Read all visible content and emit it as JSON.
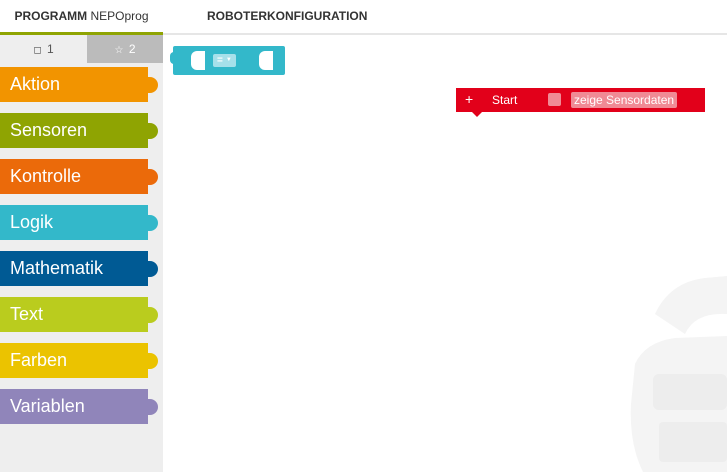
{
  "tabs": {
    "program_strong": "PROGRAMM",
    "program_name": "NEPOprog",
    "robot_config": "ROBOTERKONFIGURATION"
  },
  "toolbox": {
    "levels": [
      {
        "icon": "square-icon",
        "label": "1"
      },
      {
        "icon": "star-icon",
        "label": "2"
      }
    ],
    "categories": [
      {
        "label": "Aktion",
        "color": "#f29400"
      },
      {
        "label": "Sensoren",
        "color": "#8fa402"
      },
      {
        "label": "Kontrolle",
        "color": "#eb6a0a"
      },
      {
        "label": "Logik",
        "color": "#33b8ca"
      },
      {
        "label": "Mathematik",
        "color": "#005a94"
      },
      {
        "label": "Text",
        "color": "#bacc1e"
      },
      {
        "label": "Farben",
        "color": "#ebc300"
      },
      {
        "label": "Variablen",
        "color": "#9085ba"
      }
    ]
  },
  "workspace": {
    "compare_block": {
      "operator": "=",
      "color": "#33b8ca"
    },
    "start_block": {
      "plus": "+",
      "label": "Start",
      "sensor_label": "zeige Sensordaten",
      "color": "#e2001a"
    }
  }
}
